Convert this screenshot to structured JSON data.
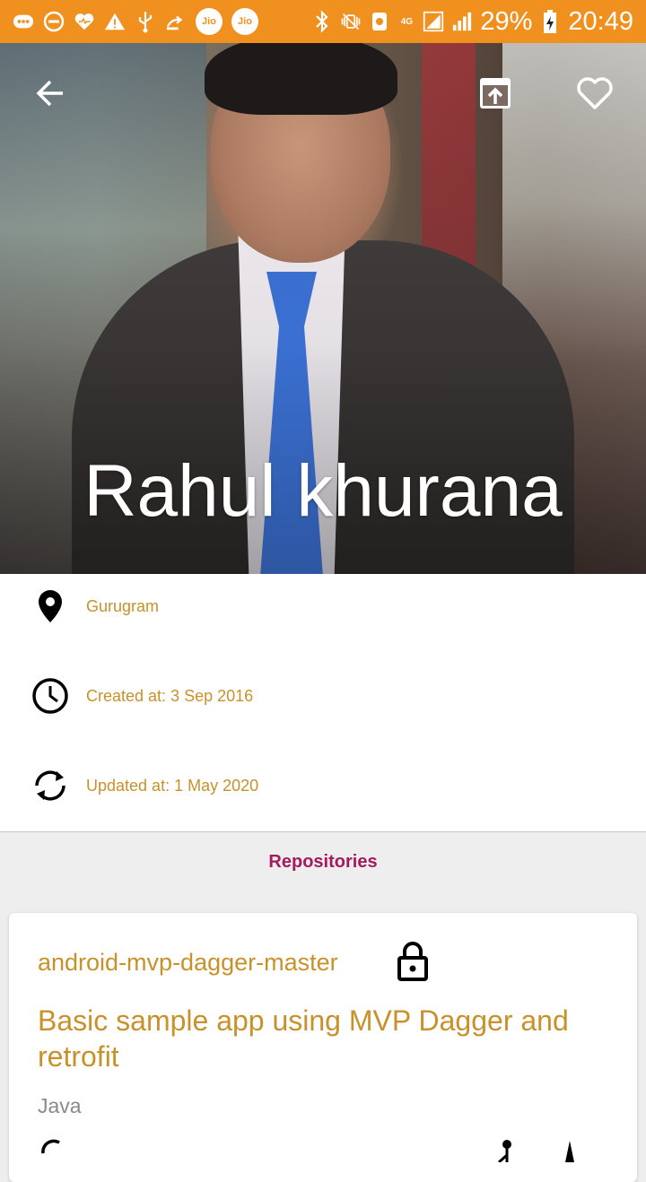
{
  "status_bar": {
    "battery_percent": "29%",
    "time": "20:49",
    "carrier_labels": [
      "Jio",
      "Jio"
    ],
    "network_label": "4G"
  },
  "profile": {
    "name": "Rahul khurana",
    "location": "Gurugram",
    "created_at": "Created at: 3 Sep 2016",
    "updated_at": "Updated at: 1 May 2020"
  },
  "repositories": {
    "section_title": "Repositories",
    "items": [
      {
        "name": "android-mvp-dagger-master",
        "description": "Basic sample app using MVP Dagger and retrofit",
        "language": "Java"
      }
    ]
  },
  "colors": {
    "status_bar": "#f0901e",
    "accent_gold": "#c8912a",
    "section_title": "#a41a5c"
  },
  "icons": {
    "back": "arrow-left-icon",
    "open": "open-in-browser-icon",
    "favorite": "heart-outline-icon",
    "location": "location-pin-icon",
    "created": "clock-icon",
    "updated": "sync-icon",
    "private": "lock-icon"
  }
}
